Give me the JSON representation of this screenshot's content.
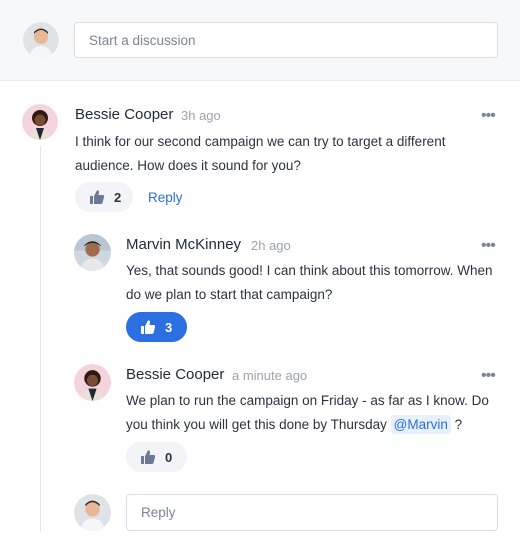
{
  "compose": {
    "placeholder": "Start a discussion"
  },
  "comments": [
    {
      "author": "Bessie Cooper",
      "time": "3h ago",
      "more": "•••",
      "text": "I think for our second campaign we can try to target a different audience. How does it sound for you?",
      "likes": "2",
      "reply_label": "Reply"
    },
    {
      "author": "Marvin McKinney",
      "time": "2h ago",
      "more": "•••",
      "text": "Yes, that sounds good! I can think about this tomorrow. When do we plan to start that campaign?",
      "likes": "3"
    },
    {
      "author": "Bessie Cooper",
      "time": "a minute ago",
      "more": "•••",
      "text_before": "We plan to run the campaign on Friday - as far as I know. Do you think you will get this done by Thursday ",
      "mention": "@Marvin",
      "text_after": " ?",
      "likes": "0"
    }
  ],
  "reply_box": {
    "placeholder": "Reply"
  },
  "colors": {
    "accent": "#2b6fe0",
    "muted": "#9aa3af"
  }
}
